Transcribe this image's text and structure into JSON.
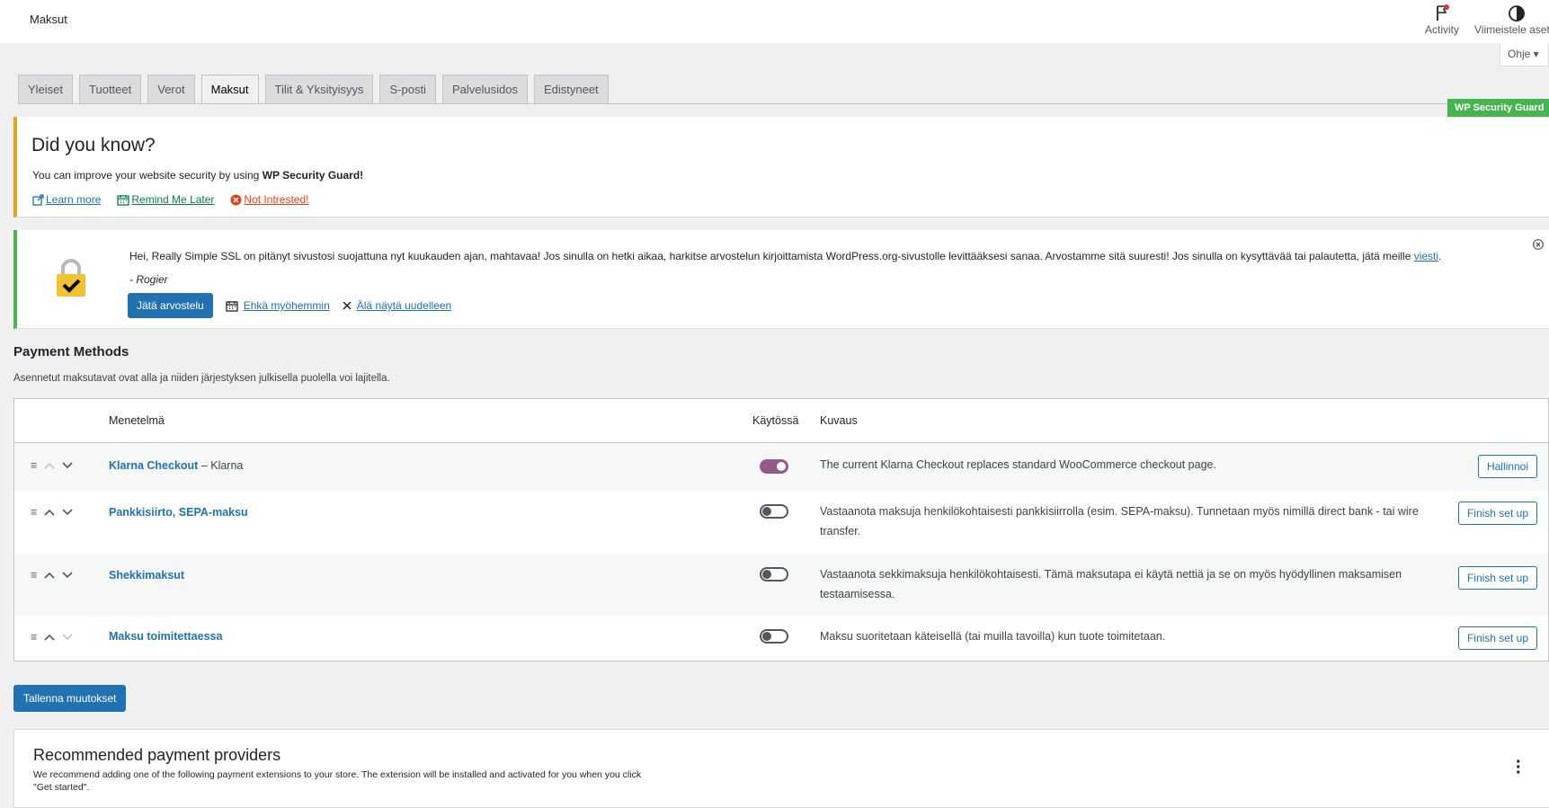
{
  "topbar": {
    "title": "Maksut",
    "activity_label": "Activity",
    "finish_setup_label": "Viimeistele aset",
    "help_label": "Ohje ▾"
  },
  "tabs": [
    {
      "label": "Yleiset"
    },
    {
      "label": "Tuotteet"
    },
    {
      "label": "Verot"
    },
    {
      "label": "Maksut"
    },
    {
      "label": "Tilit & Yksityisyys"
    },
    {
      "label": "S-posti"
    },
    {
      "label": "Palvelusidos"
    },
    {
      "label": "Edistyneet"
    }
  ],
  "wpsg_badge": "WP Security Guard",
  "notice_security": {
    "heading": "Did you know?",
    "text_prefix": "You can improve your website security by using ",
    "text_bold": "WP Security Guard!",
    "learn_more": "Learn more",
    "remind_later": "Remind Me Later",
    "not_interested": "Not Intrested!"
  },
  "notice_ssl": {
    "text": "Hei, Really Simple SSL on pitänyt sivustosi suojattuna nyt kuukauden ajan, mahtavaa! Jos sinulla on hetki aikaa, harkitse arvostelun kirjoittamista WordPress.org-sivustolle levittääksesi sanaa. Arvostamme sitä suuresti! Jos sinulla on kysyttävää tai palautetta, jätä meille ",
    "link": "viesti",
    "after": ".",
    "author": "- Rogier",
    "review_button": "Jätä arvostelu",
    "maybe_later": "Ehkä myöhemmin",
    "dont_show": "Älä näytä uudelleen"
  },
  "payment_methods": {
    "title": "Payment Methods",
    "description": "Asennetut maksutavat ovat alla ja niiden järjestyksen julkisella puolella voi lajitella.",
    "columns": {
      "method": "Menetelmä",
      "enabled": "Käytössä",
      "description": "Kuvaus"
    },
    "rows": [
      {
        "name": "Klarna Checkout",
        "sub": " – Klarna",
        "enabled": true,
        "description": "The current Klarna Checkout replaces standard WooCommerce checkout page.",
        "action": "Hallinnoi"
      },
      {
        "name": "Pankkisiirto, SEPA-maksu",
        "sub": "",
        "enabled": false,
        "description": "Vastaanota maksuja henkilökohtaisesti pankkisiirrolla (esim. SEPA-maksu). Tunnetaan myös nimillä direct bank - tai wire transfer.",
        "action": "Finish set up"
      },
      {
        "name": "Shekkimaksut",
        "sub": "",
        "enabled": false,
        "description": "Vastaanota sekkimaksuja henkilökohtaisesti. Tämä maksutapa ei käytä nettiä ja se on myös hyödyllinen maksamisen testaamisessa.",
        "action": "Finish set up"
      },
      {
        "name": "Maksu toimitettaessa",
        "sub": "",
        "enabled": false,
        "description": "Maksu suoritetaan käteisellä (tai muilla tavoilla) kun tuote toimitetaan.",
        "action": "Finish set up"
      }
    ]
  },
  "save_button": "Tallenna muutokset",
  "recommended": {
    "title": "Recommended payment providers",
    "description": "We recommend adding one of the following payment extensions to your store. The extension will be installed and activated for you when you click \"Get started\"."
  }
}
